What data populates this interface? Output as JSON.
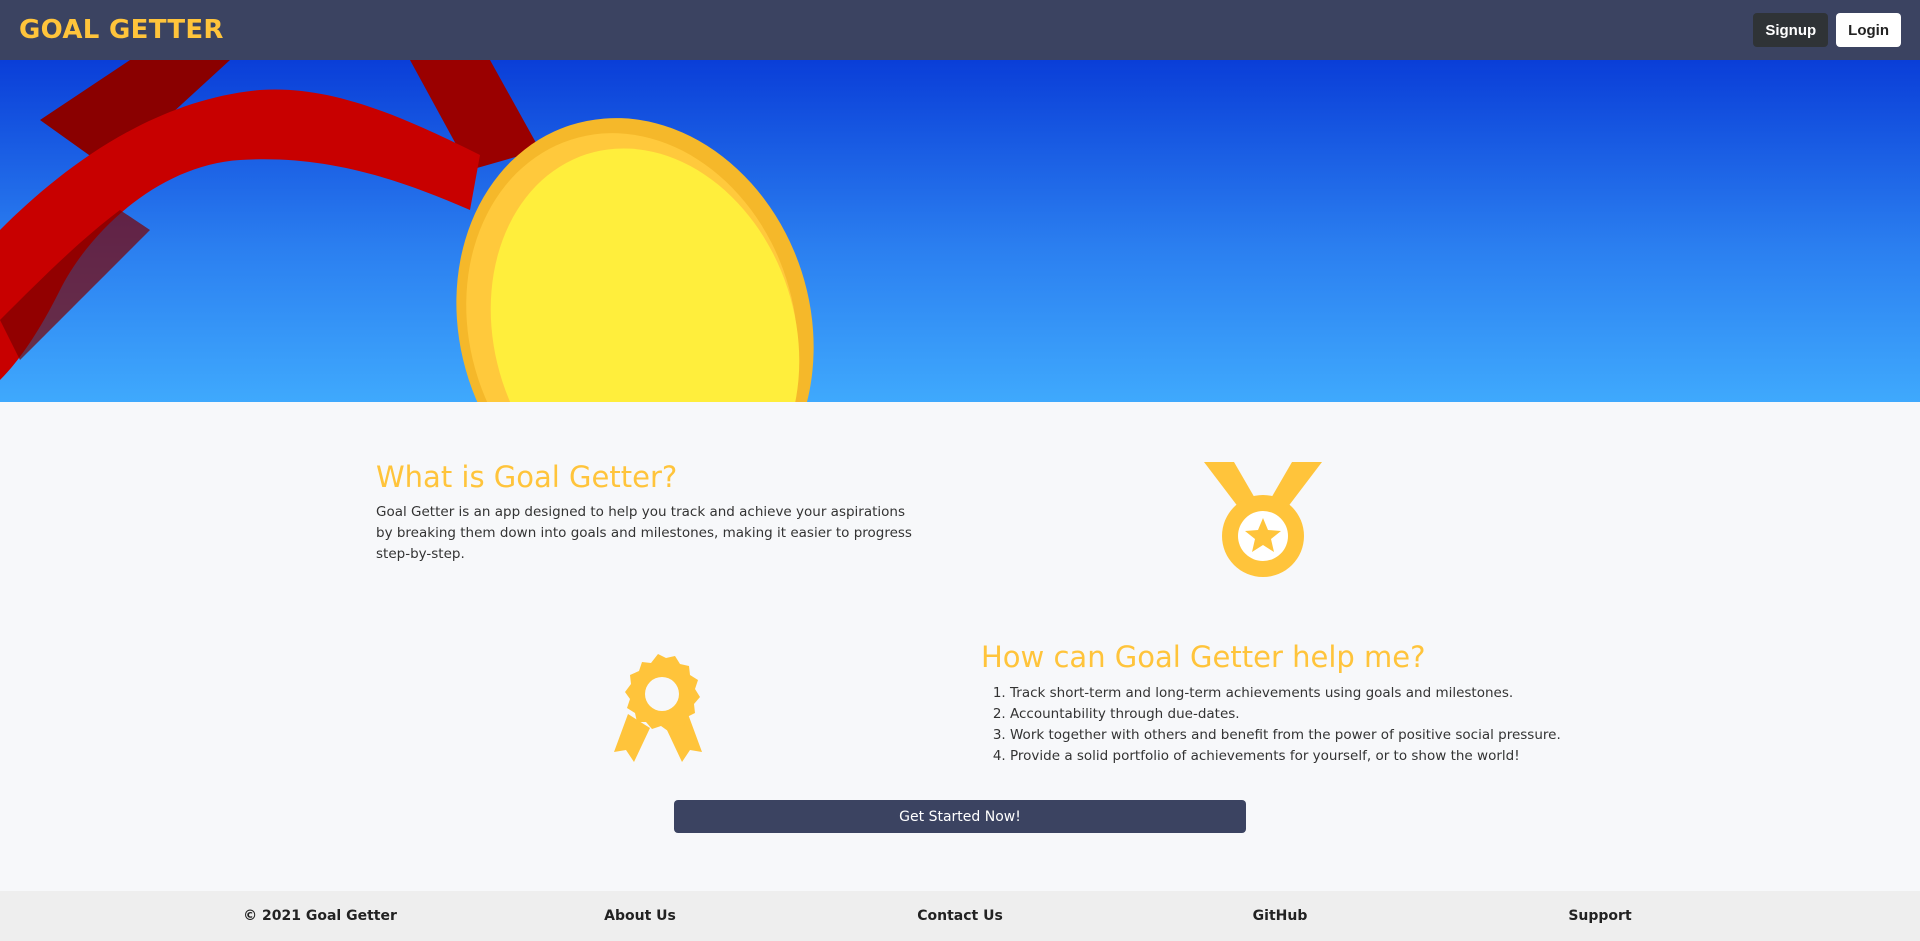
{
  "navbar": {
    "brand": "GOAL GETTER",
    "signup_label": "Signup",
    "login_label": "Login"
  },
  "about": {
    "title": "What is Goal Getter?",
    "text": "Goal Getter is an app designed to help you track and achieve your aspirations by breaking them down into goals and milestones, making it easier to progress step-by-step."
  },
  "help": {
    "title": "How can Goal Getter help me?",
    "items": [
      "Track short-term and long-term achievements using goals and milestones.",
      "Accountability through due-dates.",
      "Work together with others and benefit from the power of positive social pressure.",
      "Provide a solid portfolio of achievements for yourself, or to show the world!"
    ]
  },
  "cta_label": "Get Started Now!",
  "footer": {
    "copyright": "© 2021 Goal Getter",
    "about": "About Us",
    "contact": "Contact Us",
    "github": "GitHub",
    "support": "Support"
  },
  "colors": {
    "navbar": "#3b4361",
    "accent": "#ffc43b",
    "hero_top": "#0a3ed8",
    "hero_bottom": "#3fa9fd",
    "ribbon": "#c80000"
  },
  "icons": [
    "medal-icon",
    "award-ribbon-icon"
  ]
}
